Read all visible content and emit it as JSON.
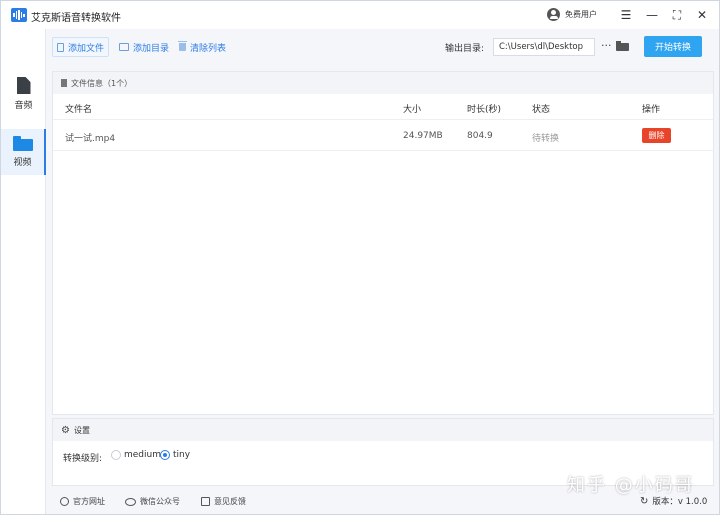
{
  "window": {
    "title": "艾克斯语音转换软件",
    "user_label": "免费用户"
  },
  "sidebar": {
    "items": [
      {
        "label": "音频",
        "icon": "document-icon"
      },
      {
        "label": "视频",
        "icon": "folder-icon",
        "selected": true
      }
    ]
  },
  "toolbar": {
    "add_file": "添加文件",
    "add_dir": "添加目录",
    "clear_list": "清除列表",
    "output_label": "输出目录:",
    "output_path": "C:\\Users\\dl\\Desktop",
    "more": "···",
    "start": "开始转换"
  },
  "file_panel": {
    "title": "文件信息（1个）",
    "columns": {
      "name": "文件名",
      "size": "大小",
      "duration": "时长(秒)",
      "status": "状态",
      "action": "操作"
    },
    "rows": [
      {
        "name": "试一试.mp4",
        "size": "24.97MB",
        "duration": "804.9",
        "status": "待转换",
        "action": "删除"
      }
    ]
  },
  "settings": {
    "title": "设置",
    "level_label": "转换级别:",
    "options": [
      {
        "label": "medium",
        "checked": false
      },
      {
        "label": "tiny",
        "checked": true
      }
    ]
  },
  "footer": {
    "website": "官方网址",
    "wechat": "微信公众号",
    "feedback": "意见反馈",
    "version": "版本：v 1.0.0"
  },
  "watermark": "知乎 @小码哥",
  "colors": {
    "accent": "#2c7ce5",
    "start_button": "#2fa4f0",
    "delete_button": "#e8442a"
  }
}
